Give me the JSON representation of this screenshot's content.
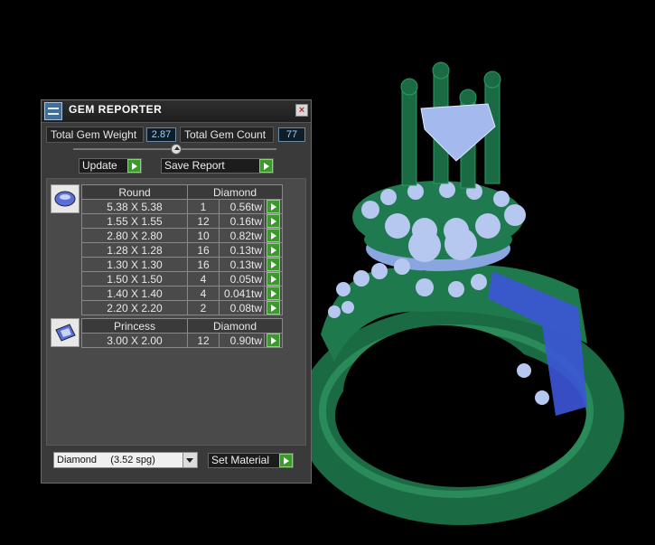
{
  "window": {
    "title": "GEM REPORTER",
    "close_glyph": "×"
  },
  "stats": {
    "weight_label": "Total Gem Weight",
    "weight_value": "2.87",
    "count_label": "Total Gem Count",
    "count_value": "77"
  },
  "toolbar": {
    "update_label": "Update",
    "save_report_label": "Save Report"
  },
  "groups": [
    {
      "shape": "Round",
      "material": "Diamond",
      "rows": [
        {
          "size": "5.38 X 5.38",
          "qty": "1",
          "weight": "0.56tw"
        },
        {
          "size": "1.55 X 1.55",
          "qty": "12",
          "weight": "0.16tw"
        },
        {
          "size": "2.80 X 2.80",
          "qty": "10",
          "weight": "0.82tw"
        },
        {
          "size": "1.28 X 1.28",
          "qty": "16",
          "weight": "0.13tw"
        },
        {
          "size": "1.30 X 1.30",
          "qty": "16",
          "weight": "0.13tw"
        },
        {
          "size": "1.50 X 1.50",
          "qty": "4",
          "weight": "0.05tw"
        },
        {
          "size": "1.40 X 1.40",
          "qty": "4",
          "weight": "0.041tw"
        },
        {
          "size": "2.20 X 2.20",
          "qty": "2",
          "weight": "0.08tw"
        }
      ]
    },
    {
      "shape": "Princess",
      "material": "Diamond",
      "rows": [
        {
          "size": "3.00 X 2.00",
          "qty": "12",
          "weight": "0.90tw"
        }
      ]
    }
  ],
  "material_select": {
    "selected": "Diamond     (3.52 spg)"
  },
  "set_material_label": "Set Material",
  "icons": {
    "go": "green-play-icon",
    "round": "round-gem-icon",
    "princess": "princess-gem-icon",
    "window": "gem-reporter-icon"
  },
  "colors": {
    "ring_metal": "#1f7a4f",
    "gem": "#9fb6ea",
    "princess_gem": "#3c55d8",
    "accent_green": "#3a9a2a"
  }
}
